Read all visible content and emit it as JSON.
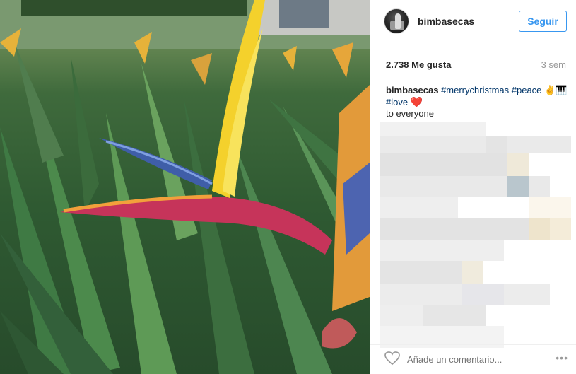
{
  "post": {
    "image_alt": "Bird of paradise flower",
    "username": "bimbasecas",
    "follow_label": "Seguir",
    "likes": "2.738 Me gusta",
    "time_ago": "3 sem",
    "caption": {
      "user": "bimbasecas",
      "tags_line1": [
        "#merrychristmas",
        "#peace"
      ],
      "emoji1": "✌🎹",
      "tag_line2": "#love",
      "emoji2": "❤️",
      "line3": "to everyone"
    }
  },
  "comment": {
    "placeholder": "Añade un comentario...",
    "more_label": "•••"
  },
  "icons": {
    "avatar": "avatar",
    "like": "heart-outline-icon",
    "more": "more-options-icon"
  },
  "colors": {
    "accent": "#3897f0",
    "hashtag": "#003569",
    "muted": "#999999"
  }
}
